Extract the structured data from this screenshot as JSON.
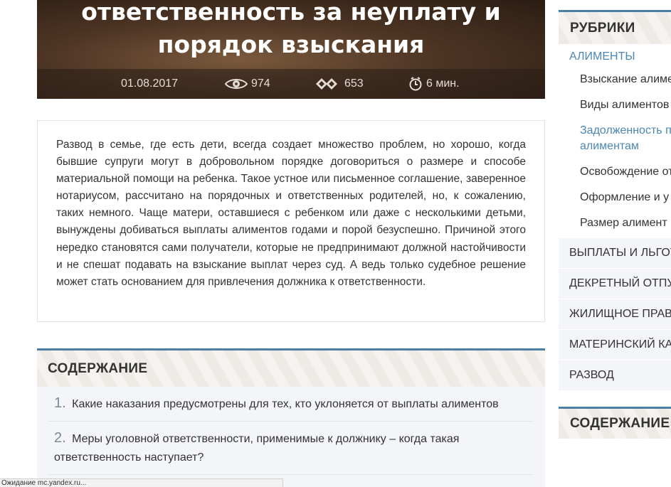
{
  "hero": {
    "title_line1": "ответственность за неуплату и",
    "title_line2": "порядок взыскания",
    "date": "01.08.2017",
    "views": "974",
    "comments": "653",
    "read_time": "6 мин."
  },
  "intro": {
    "text": "Развод в семье, где есть дети, всегда создает множество проблем, но хорошо, когда бывшие супруги могут в добровольном порядке договориться о размере и способе материальной помощи на ребенка. Такое устное или письменное соглашение, заверенное нотариусом, рассчитано на порядочных и ответственных родителей, но, к сожалению, таких немного. Чаще матери, оставшиеся с ребенком или даже с несколькими детьми, вынуждены добиваться выплаты алиментов годами и порой безуспешно. Причиной этого нередко становятся сами получатели, которые не предпринимают должной настойчивости и не спешат подавать на взыскание выплат через суд. А ведь только судебное решение может стать основанием для привлечения должника к ответственности."
  },
  "toc": {
    "title": "СОДЕРЖАНИЕ",
    "items": [
      {
        "num": "1.",
        "text": "Какие наказания предусмотрены для тех, кто уклоняется от выплаты алиментов"
      },
      {
        "num": "2.",
        "text": "Меры уголовной ответственности, применимые к должнику – когда такая ответственность наступает?"
      }
    ]
  },
  "sidebar": {
    "title": "РУБРИКИ",
    "active_category": "АЛИМЕНТЫ",
    "subitems": [
      "Взыскание алиментов",
      "Виды алиментов",
      "Задолженность по алиментам",
      "Освобождение от",
      "Оформление и у",
      "Размер алимент"
    ],
    "categories": [
      "ВЫПЛАТЫ И ЛЬГОТЫ",
      "ДЕКРЕТНЫЙ ОТПУСК",
      "ЖИЛИЩНОЕ ПРАВО",
      "МАТЕРИНСКИЙ КАПИТАЛ",
      "РАЗВОД"
    ],
    "contents_title": "СОДЕРЖАНИЕ"
  },
  "statusbar": {
    "text": "Ожидание mc.yandex.ru..."
  },
  "colors": {
    "accent": "#4b86b4",
    "border_accent": "#4b7ea3"
  }
}
